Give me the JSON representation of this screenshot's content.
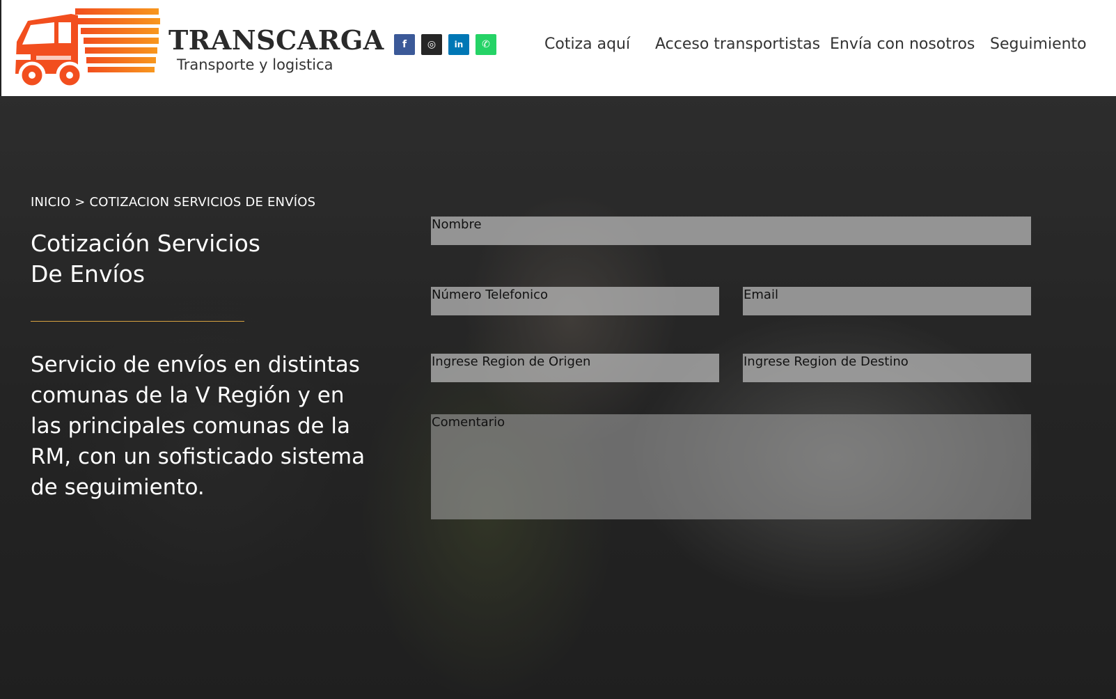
{
  "brand": {
    "name": "TRANSCARGA",
    "tagline": "Transporte y logistica",
    "logo_icon": "truck-icon",
    "logo_color_start": "#f7971e",
    "logo_color_end": "#f24e1e"
  },
  "socials": [
    {
      "name": "facebook-icon",
      "glyph": "f",
      "color": "#3b5998"
    },
    {
      "name": "instagram-icon",
      "glyph": "◎",
      "color": "#262626"
    },
    {
      "name": "linkedin-icon",
      "glyph": "in",
      "color": "#0077b5"
    },
    {
      "name": "whatsapp-icon",
      "glyph": "✆",
      "color": "#25d366"
    }
  ],
  "nav": {
    "cotiza": "Cotiza aquí",
    "acceso": "Acceso transportistas",
    "envia": "Envía con nosotros",
    "seguimiento": "Seguimiento"
  },
  "hero": {
    "breadcrumb_home": "INICIO",
    "breadcrumb_sep": ">",
    "breadcrumb_current": "COTIZACION SERVICIOS DE ENVÍOS",
    "title_line1": "Cotización Servicios",
    "title_line2": "De Envíos",
    "description": "Servicio de envíos en distintas comunas de la V Región y en las principales comunas de la RM, con un sofisticado sistema de seguimiento.",
    "rule_color": "#d9a441"
  },
  "form": {
    "nombre": "Nombre",
    "telefono": "Número Telefonico",
    "email": "Email",
    "origen": "Ingrese Region de Origen",
    "destino": "Ingrese Region de Destino",
    "comentario": "Comentario"
  }
}
